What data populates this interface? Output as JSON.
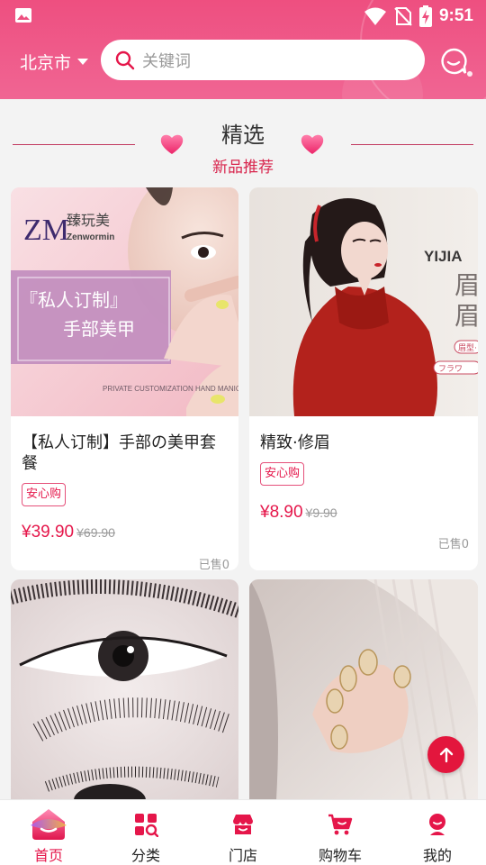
{
  "status_bar": {
    "time": "9:51"
  },
  "header": {
    "city": "北京市",
    "search_placeholder": "关键词"
  },
  "section": {
    "title": "精选",
    "subtitle": "新品推荐"
  },
  "products": [
    {
      "name": "【私人订制】手部の美甲套餐",
      "tag": "安心购",
      "price": "¥39.90",
      "original_price": "¥69.90",
      "sold": "已售0",
      "image_text": {
        "brand_cn": "臻玩美",
        "brand_en": "Zenwormin",
        "logo": "ZM",
        "banner_line1": "『私人订制』",
        "banner_line2": "手部美甲",
        "caption": "PRIVATE CUSTOMIZATION HAND MANICURE"
      }
    },
    {
      "name": "精致·修眉",
      "tag": "安心购",
      "price": "¥8.90",
      "original_price": "¥9.90",
      "sold": "已售0",
      "image_text": {
        "brand": "YIJIA",
        "vertical1": "眉",
        "vertical2": "眉",
        "small1": "眉型·ラ",
        "small2": "フラワ"
      }
    },
    {
      "name": "",
      "tag": "",
      "price": "",
      "original_price": "",
      "sold": ""
    },
    {
      "name": "",
      "tag": "",
      "price": "",
      "original_price": "",
      "sold": ""
    }
  ],
  "tabs": [
    {
      "label": "首页",
      "icon": "home-icon",
      "active": true
    },
    {
      "label": "分类",
      "icon": "category-icon",
      "active": false
    },
    {
      "label": "门店",
      "icon": "store-icon",
      "active": false
    },
    {
      "label": "购物车",
      "icon": "cart-icon",
      "active": false
    },
    {
      "label": "我的",
      "icon": "profile-icon",
      "active": false
    }
  ],
  "colors": {
    "brand": "#ee4f80",
    "price": "#e5164a",
    "fab": "#e3163d"
  }
}
